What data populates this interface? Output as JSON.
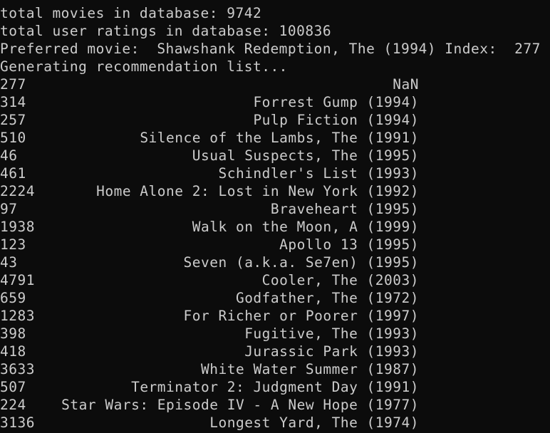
{
  "header": {
    "total_movies": "total movies in database: 9742",
    "total_ratings": "total user ratings in database: 100836",
    "preferred": "Preferred movie:  Shawshank Redemption, The (1994) Index:  277",
    "generating": "Generating recommendation list..."
  },
  "recommendations": [
    {
      "index": "277",
      "title": "NaN"
    },
    {
      "index": "314",
      "title": "Forrest Gump (1994)"
    },
    {
      "index": "257",
      "title": "Pulp Fiction (1994)"
    },
    {
      "index": "510",
      "title": "Silence of the Lambs, The (1991)"
    },
    {
      "index": "46",
      "title": "Usual Suspects, The (1995)"
    },
    {
      "index": "461",
      "title": "Schindler's List (1993)"
    },
    {
      "index": "2224",
      "title": "Home Alone 2: Lost in New York (1992)"
    },
    {
      "index": "97",
      "title": "Braveheart (1995)"
    },
    {
      "index": "1938",
      "title": "Walk on the Moon, A (1999)"
    },
    {
      "index": "123",
      "title": "Apollo 13 (1995)"
    },
    {
      "index": "43",
      "title": "Seven (a.k.a. Se7en) (1995)"
    },
    {
      "index": "4791",
      "title": "Cooler, The (2003)"
    },
    {
      "index": "659",
      "title": "Godfather, The (1972)"
    },
    {
      "index": "1283",
      "title": "For Richer or Poorer (1997)"
    },
    {
      "index": "398",
      "title": "Fugitive, The (1993)"
    },
    {
      "index": "418",
      "title": "Jurassic Park (1993)"
    },
    {
      "index": "3633",
      "title": "White Water Summer (1987)"
    },
    {
      "index": "507",
      "title": "Terminator 2: Judgment Day (1991)"
    },
    {
      "index": "224",
      "title": "Star Wars: Episode IV - A New Hope (1977)"
    },
    {
      "index": "3136",
      "title": "Longest Yard, The (1974)"
    }
  ],
  "colors": {
    "background": "#0c0c0c",
    "text": "#cccccc"
  }
}
